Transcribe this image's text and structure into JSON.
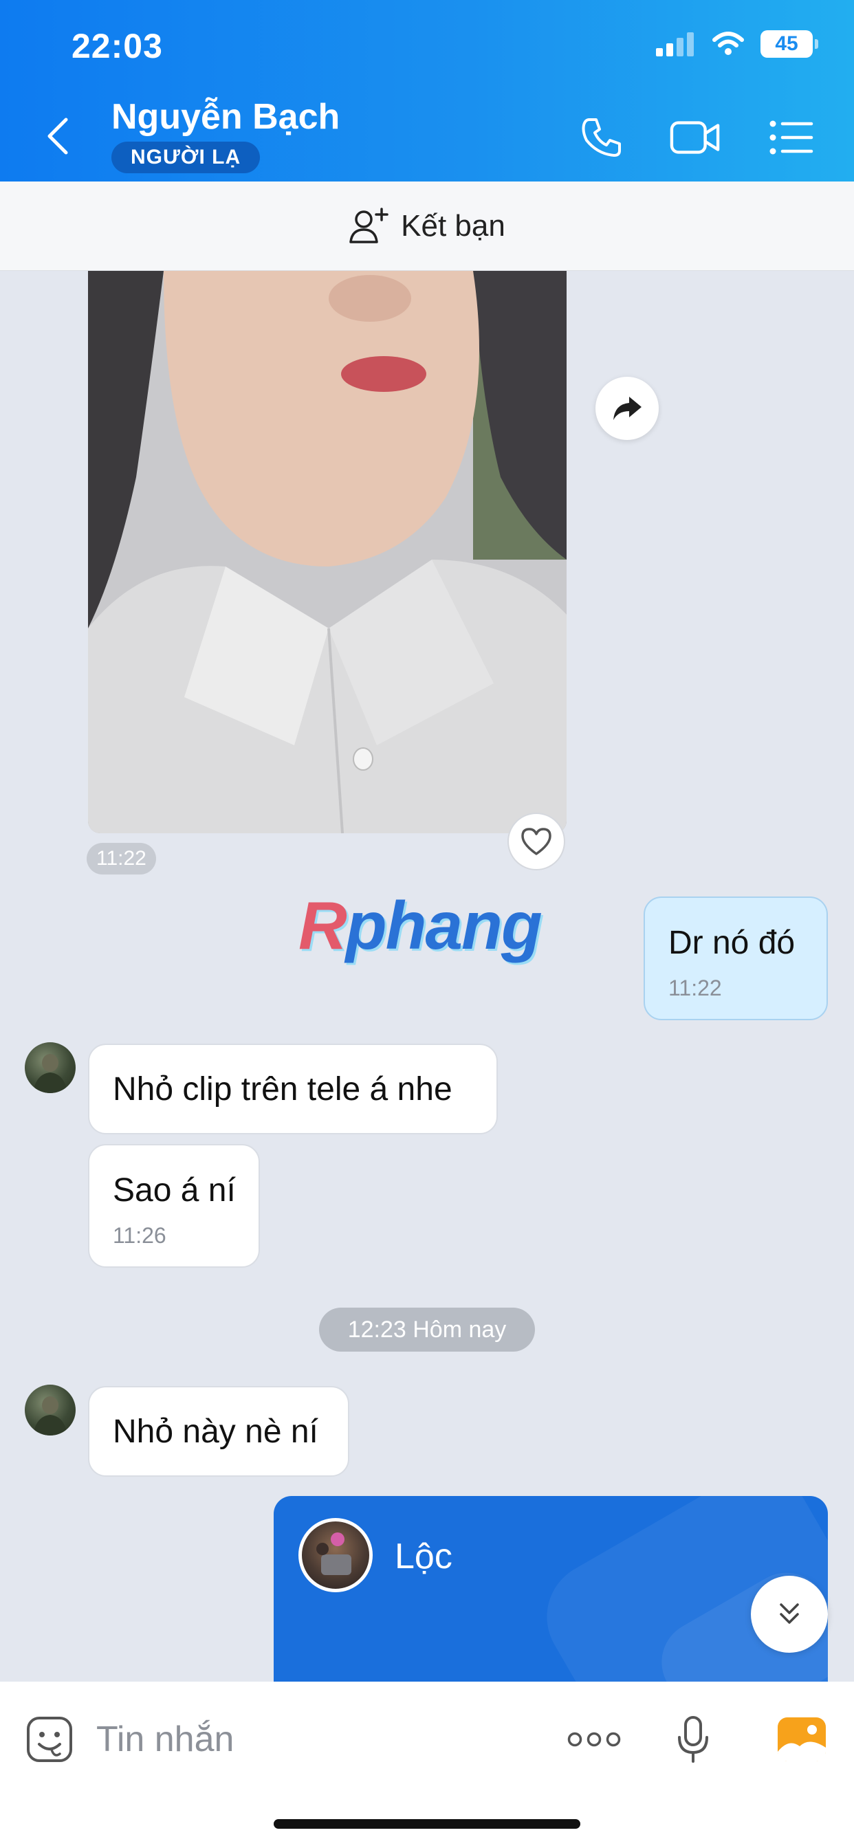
{
  "status_bar": {
    "time": "22:03",
    "battery": "45"
  },
  "header": {
    "name": "Nguyễn Bạch",
    "badge": "NGƯỜI LẠ"
  },
  "friend_bar": {
    "label": "Kết bạn"
  },
  "photo_message": {
    "time": "11:22"
  },
  "watermark": {
    "first": "R",
    "rest": "phang"
  },
  "messages": [
    {
      "side": "me",
      "text": "Dr nó đó",
      "time": "11:22"
    },
    {
      "side": "them",
      "text": "Nhỏ clip trên tele á nhe",
      "time": ""
    },
    {
      "side": "them",
      "text": "Sao á ní",
      "time": "11:26"
    },
    {
      "side": "them",
      "text": "Nhỏ này nè ní",
      "time": ""
    }
  ],
  "date_separator": "12:23 Hôm nay",
  "contact_card": {
    "name": "Lộc"
  },
  "composer": {
    "placeholder": "Tin nhắn"
  },
  "colors": {
    "header_start": "#0e7bf0",
    "header_end": "#22aef0",
    "my_bubble": "#d6efff",
    "card": "#1a6fdc"
  },
  "icons": [
    "back-icon",
    "phone-icon",
    "video-call-icon",
    "menu-list-icon",
    "add-friend-icon",
    "forward-icon",
    "heart-icon",
    "chevron-double-down-icon",
    "sticker-icon",
    "more-icon",
    "microphone-icon",
    "image-icon"
  ]
}
